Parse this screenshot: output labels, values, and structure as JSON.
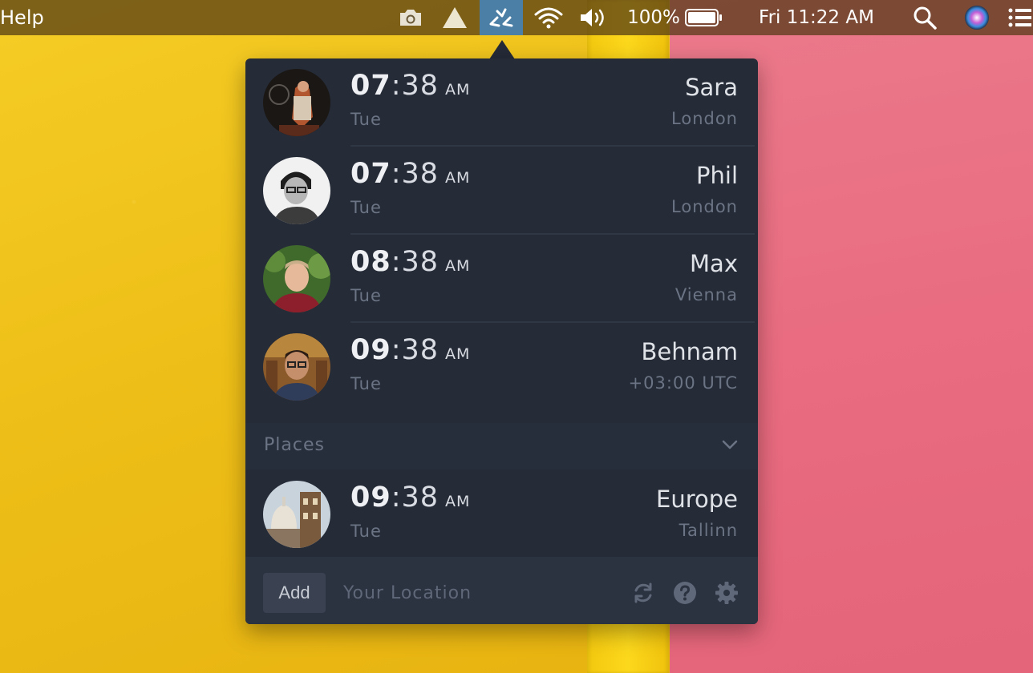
{
  "menubar": {
    "help_label": "Help",
    "battery_label": "100%",
    "clock_label": "Fri 11:22 AM"
  },
  "people": [
    {
      "hour": "07",
      "minute": ":38",
      "ampm": "AM",
      "day": "Tue",
      "name": "Sara",
      "place": "London"
    },
    {
      "hour": "07",
      "minute": ":38",
      "ampm": "AM",
      "day": "Tue",
      "name": "Phil",
      "place": "London"
    },
    {
      "hour": "08",
      "minute": ":38",
      "ampm": "AM",
      "day": "Tue",
      "name": "Max",
      "place": "Vienna"
    },
    {
      "hour": "09",
      "minute": ":38",
      "ampm": "AM",
      "day": "Tue",
      "name": "Behnam",
      "place": "+03:00 UTC"
    }
  ],
  "places_section": {
    "label": "Places"
  },
  "places": [
    {
      "hour": "09",
      "minute": ":38",
      "ampm": "AM",
      "day": "Tue",
      "name": "Europe",
      "place": "Tallinn"
    }
  ],
  "footer": {
    "add_label": "Add",
    "location_placeholder": "Your Location"
  },
  "colors": {
    "popover_bg": "#252b37",
    "menubar_active": "#4b7fa6",
    "wall_yellow": "#f2c51f",
    "wall_pink": "#e96c80"
  }
}
